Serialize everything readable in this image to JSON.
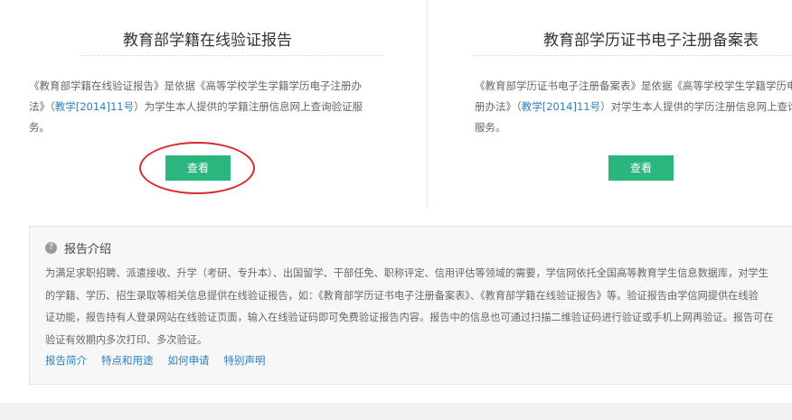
{
  "left_card": {
    "title": "教育部学籍在线验证报告",
    "desc_line1": "《教育部学籍在线验证报告》是依据《高等学校学生学籍学历电子注册办",
    "desc_line2_pre": "法》（",
    "desc_link": "教学[2014]11号",
    "desc_line2_post": "）为学生本人提供的学籍注册信息网上查询验证服",
    "desc_line3": "务。",
    "button": "查看"
  },
  "right_card": {
    "title": "教育部学历证书电子注册备案表",
    "desc_line1": "《教育部学历证书电子注册备案表》是依据《高等学校学生学籍学历电子注",
    "desc_line2_pre": "册办法》（",
    "desc_link": "教学[2014]11号",
    "desc_line2_post": "）对学生本人提供的学历注册信息网上查询验证",
    "desc_line3": "服务。",
    "button": "查看"
  },
  "info": {
    "heading": "报告介绍",
    "lines": [
      "为满足求职招聘、派遣接收、升学（考研、专升本）、出国留学、干部任免、职称评定、信用评估等领域的需要，学信网依托全国高等教育学生信息数据库，对学生",
      "的学籍、学历、招生录取等相关信息提供在线验证报告，如：《教育部学历证书电子注册备案表》、《教育部学籍在线验证报告》等。验证报告由学信网提供在线验",
      "证功能，报告持有人登录网站在线验证页面，输入在线验证码即可免费验证报告内容。报告中的信息也可通过扫描二维验证码进行验证或手机上网再验证。报告可在",
      "验证有效期内多次打印、多次验证。"
    ],
    "links": [
      "报告简介",
      "特点和用途",
      "如何申请",
      "特别声明"
    ]
  }
}
